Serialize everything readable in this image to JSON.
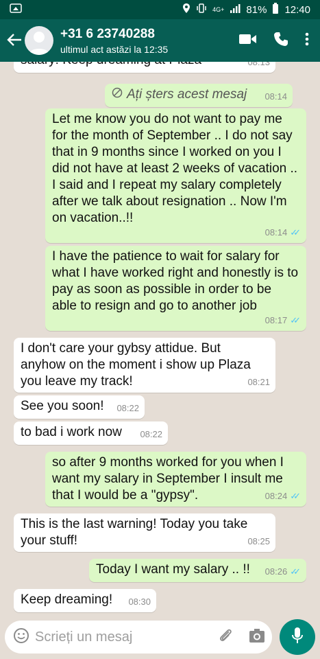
{
  "status_bar": {
    "network": "4G+",
    "battery": "81%",
    "time": "12:40"
  },
  "header": {
    "contact_name": "+31 6 23740288",
    "last_seen": "ultimul act astăzi la 12:35"
  },
  "messages": [
    {
      "text": "salary! Keep dreaming at Plaza",
      "time": "08:13"
    },
    {
      "text": "Ați șters acest mesaj",
      "time": "08:14"
    },
    {
      "text": "Let me know you do not want to pay me for the month of September .. I do not say that in 9 months since I worked on you I did not have at least 2 weeks of vacation .. I said and I repeat my salary completely after we talk about resignation .. Now I'm on vacation..!!",
      "time": "08:14"
    },
    {
      "text": "I have the patience to wait for salary for what I have worked right and honestly is to pay as soon as possible in order to be able to resign and go to another job",
      "time": "08:17"
    },
    {
      "text": "I don't care your gybsy attidue. But anyhow on the moment i show up Plaza you leave my track!",
      "time": "08:21"
    },
    {
      "text": "See you soon!",
      "time": "08:22"
    },
    {
      "text": "to bad i work now",
      "time": "08:22"
    },
    {
      "text": "so after 9 months worked for you when I want my salary in September I insult me that I would be a \"gypsy\".",
      "time": "08:24"
    },
    {
      "text": "This is the last warning! Today you take your stuff!",
      "time": "08:25"
    },
    {
      "text": "Today I want my salary .. !!",
      "time": "08:26"
    },
    {
      "text": "Keep dreaming!",
      "time": "08:30"
    }
  ],
  "composer": {
    "placeholder": "Scrieți un mesaj"
  },
  "colors": {
    "header": "#075e54",
    "status_bar": "#004d40",
    "outgoing_bubble": "#dcf8c6",
    "incoming_bubble": "#ffffff",
    "read_ticks": "#4fc3f7",
    "mic_button": "#00897b",
    "chat_background": "#e5ddd5"
  },
  "icons": [
    "wifi-icon",
    "location-icon",
    "vibrate-icon",
    "signal-icon",
    "battery-icon",
    "back-arrow-icon",
    "video-call-icon",
    "voice-call-icon",
    "more-options-icon",
    "blocked-icon",
    "emoji-icon",
    "attach-icon",
    "camera-icon",
    "mic-icon"
  ]
}
